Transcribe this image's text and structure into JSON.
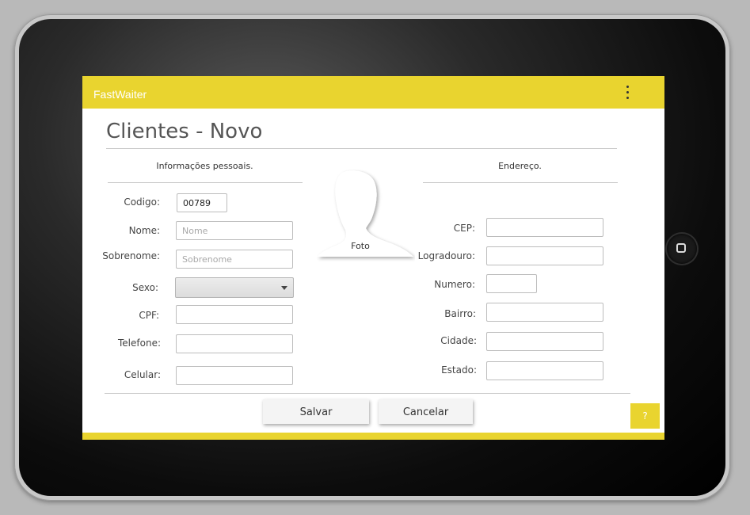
{
  "app": {
    "title": "FastWaiter"
  },
  "page": {
    "title": "Clientes - Novo"
  },
  "sections": {
    "personal": "Informações pessoais.",
    "address": "Endereço."
  },
  "personal": {
    "codigo": {
      "label": "Codigo:",
      "value": "00789"
    },
    "nome": {
      "label": "Nome:",
      "placeholder": "Nome"
    },
    "sobrenome": {
      "label": "Sobrenome:",
      "placeholder": "Sobrenome"
    },
    "sexo": {
      "label": "Sexo:",
      "value": ""
    },
    "cpf": {
      "label": "CPF:"
    },
    "telefone": {
      "label": "Telefone:"
    },
    "celular": {
      "label": "Celular:"
    }
  },
  "photo": {
    "label": "Foto"
  },
  "address": {
    "cep": {
      "label": "CEP:"
    },
    "logradouro": {
      "label": "Logradouro:"
    },
    "numero": {
      "label": "Numero:"
    },
    "bairro": {
      "label": "Bairro:"
    },
    "cidade": {
      "label": "Cidade:"
    },
    "estado": {
      "label": "Estado:"
    }
  },
  "actions": {
    "save": "Salvar",
    "cancel": "Cancelar",
    "help": "?"
  },
  "colors": {
    "accent": "#e9d42f"
  },
  "icons": {
    "menu": "more-vert-icon",
    "photo": "person-silhouette-icon",
    "home": "home-button-icon"
  }
}
